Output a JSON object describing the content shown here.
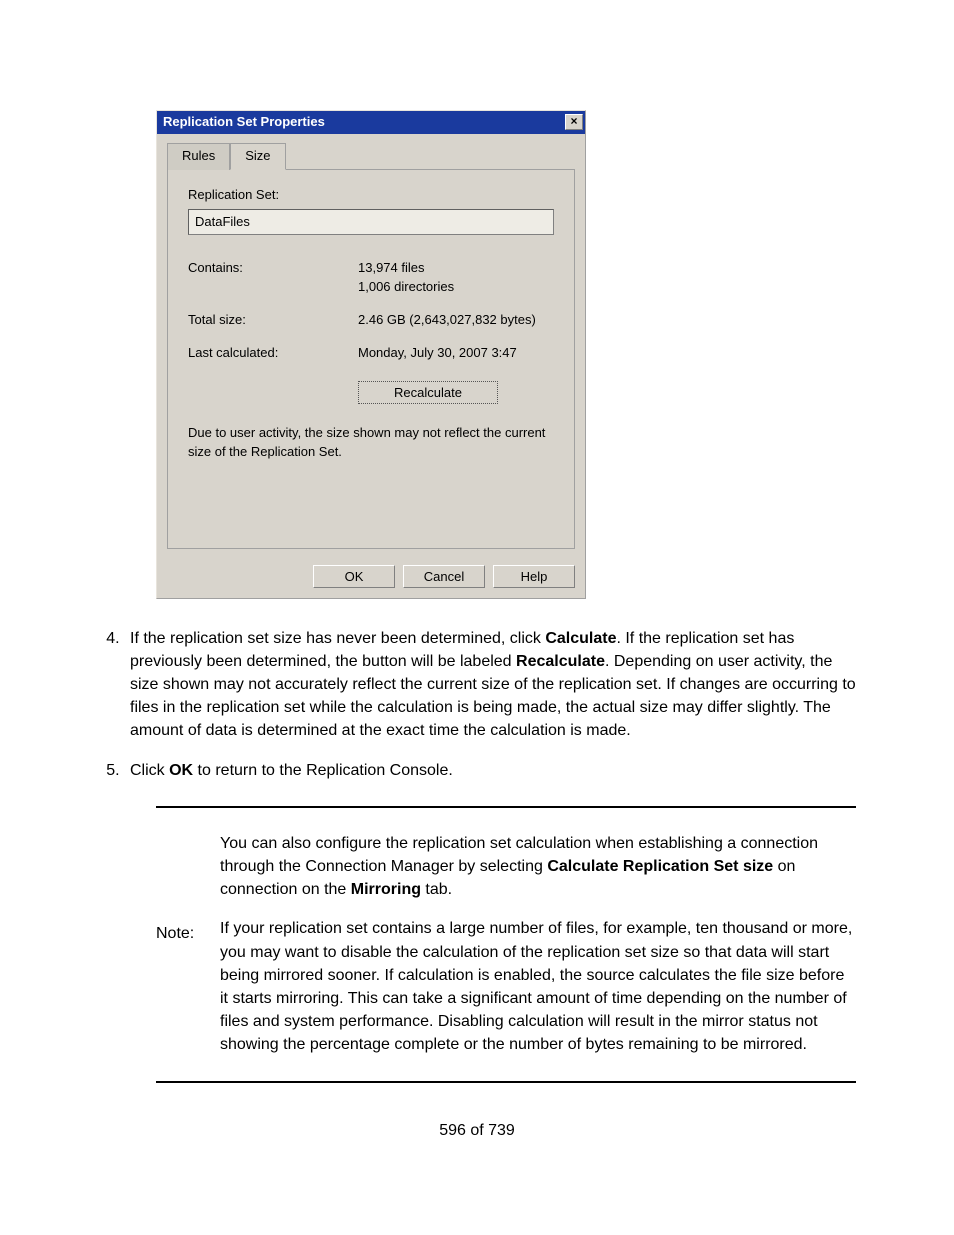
{
  "dialog": {
    "title": "Replication Set Properties",
    "tabs": {
      "rules": "Rules",
      "size": "Size"
    },
    "replication_set_label": "Replication Set:",
    "replication_set_value": "DataFiles",
    "contains_label": "Contains:",
    "contains_files": "13,974 files",
    "contains_dirs": "1,006 directories",
    "total_size_label": "Total size:",
    "total_size_value": "2.46 GB (2,643,027,832 bytes)",
    "last_calc_label": "Last calculated:",
    "last_calc_value": "Monday, July 30, 2007 3:47",
    "recalc_button": "Recalculate",
    "size_note": "Due to user activity, the size shown may not reflect the current size of the Replication Set.",
    "ok": "OK",
    "cancel": "Cancel",
    "help": "Help"
  },
  "step4": {
    "num": "4.",
    "pre": "If the replication set size has never been determined, click ",
    "b1": "Calculate",
    "mid": ". If the replication set has previously been determined, the button will be labeled ",
    "b2": "Recalculate",
    "post": ". Depending on user activity, the size shown may not accurately reflect the current size of the replication set. If changes are occurring to files in the replication set while the calculation is being made, the actual size may differ slightly. The amount of data is determined at the exact time the calculation is made."
  },
  "step5": {
    "num": "5.",
    "pre": "Click ",
    "b1": "OK",
    "post": " to return to the Replication Console."
  },
  "note": {
    "label": "Note:",
    "p1a": "You can also configure the replication set calculation when establishing a connection through the Connection Manager by selecting ",
    "p1b": "Calculate Replication Set size",
    "p1c": " on connection on the ",
    "p1d": "Mirroring",
    "p1e": " tab.",
    "p2": "If your replication set contains a large number of files, for example, ten thousand or more, you may want to disable the calculation of the replication set size so that data will start being mirrored sooner. If calculation is enabled, the source calculates the file size before it starts mirroring. This can take a significant amount of time depending on the number of files and system performance. Disabling calculation will result in the mirror status not showing the percentage complete or the number of bytes remaining to be mirrored."
  },
  "pager": "596 of 739"
}
